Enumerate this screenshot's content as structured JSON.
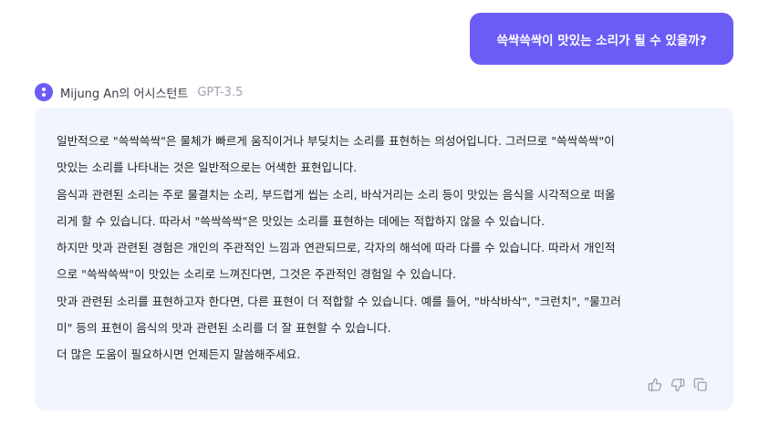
{
  "user_message": {
    "text": "쓱싹쓱싹이 맛있는 소리가 될 수 있을까?"
  },
  "assistant": {
    "name": "Mijung An의 어시스턴트",
    "model": "GPT-3.5",
    "answer_lines": [
      "일반적으로 \"쓱싹쓱싹\"은 물체가 빠르게 움직이거나 부딪치는 소리를 표현하는 의성어입니다. 그러므로 \"쓱싹쓱싹\"이",
      "맛있는 소리를 나타내는 것은 일반적으로는 어색한 표현입니다.",
      "음식과 관련된 소리는 주로 물결치는 소리, 부드럽게 씹는 소리, 바삭거리는 소리 등이 맛있는 음식을 시각적으로 떠올",
      "리게 할 수 있습니다. 따라서 \"쓱싹쓱싹\"은 맛있는 소리를 표현하는 데에는 적합하지 않을 수 있습니다.",
      "하지만 맛과 관련된 경험은 개인의 주관적인 느낌과 연관되므로, 각자의 해석에 따라 다를 수 있습니다. 따라서 개인적",
      "으로 \"쓱싹쓱싹\"이 맛있는 소리로 느껴진다면, 그것은 주관적인 경험일 수 있습니다.",
      "맛과 관련된 소리를 표현하고자 한다면, 다른 표현이 더 적합할 수 있습니다. 예를 들어, \"바삭바삭\", \"크런치\", \"물끄러",
      "미\" 등의 표현이 음식의 맛과 관련된 소리를 더 잘 표현할 수 있습니다.",
      "더 많은 도움이 필요하시면 언제든지 말씀해주세요."
    ]
  },
  "actions": {
    "icons": [
      "thumbs-up-icon",
      "thumbs-down-icon",
      "copy-icon"
    ]
  },
  "colors": {
    "accent": "#6b5cf6",
    "answer_bg": "#f1f5fd",
    "icon": "#9ca3af"
  }
}
